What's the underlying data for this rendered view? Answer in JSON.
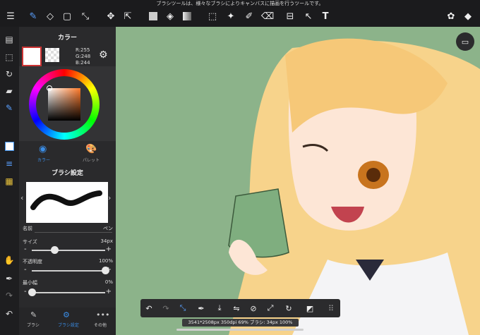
{
  "top_hint": "ブラシツールは、様々なブラシによりキャンバスに描画を行うツールです。",
  "color_panel": {
    "title": "カラー",
    "rgb_r": "R:255",
    "rgb_g": "G:248",
    "rgb_b": "B:244",
    "tab_color": "カラー",
    "tab_palette": "パレット"
  },
  "brush_panel": {
    "title": "ブラシ設定",
    "name_label": "名前",
    "name_value": "ペン",
    "size_label": "サイズ",
    "size_value": "34px",
    "size_level": 0.31,
    "opacity_label": "不透明度",
    "opacity_value": "100%",
    "opacity_level": 1.0,
    "minwidth_label": "最小幅",
    "minwidth_value": "0%",
    "minwidth_level": 0.0
  },
  "bottom_tabs": {
    "brush": "ブラシ",
    "brush_settings": "ブラシ設定",
    "other": "その他"
  },
  "status_text": "3541*2508px 350dpi 69% ブラシ: 34px 100%",
  "colors": {
    "canvas_bg": "#8cb38a",
    "accent": "#3b8ee8",
    "panel_bg": "#2a2a2c"
  }
}
